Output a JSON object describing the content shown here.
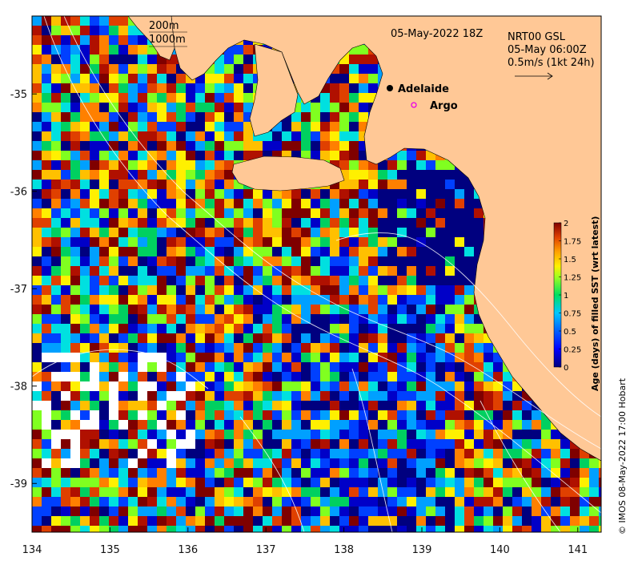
{
  "map": {
    "title": "05-May-2022 18Z",
    "contour_labels": [
      "200m",
      "1000m"
    ],
    "info_lines": [
      "NRT00 GSL",
      "05-May 06:00Z",
      "0.5m/s (1kt 24h)"
    ],
    "places": [
      {
        "name": "Adelaide",
        "lon": 138.6,
        "lat": -34.93,
        "marker": "filled-circle"
      },
      {
        "name": "Argo",
        "lon": 138.8,
        "lat": -35.12,
        "marker": "open-circle"
      }
    ],
    "lon_ticks": [
      "134",
      "135",
      "136",
      "137",
      "138",
      "139",
      "140",
      "141"
    ],
    "lat_ticks": [
      "-35",
      "-36",
      "-37",
      "-38",
      "-39"
    ],
    "lon_range": [
      134,
      141.3
    ],
    "lat_range": [
      -39.5,
      -34.2
    ],
    "land_color": "#FFC896",
    "colorbar": {
      "title": "Age (days) of filled SST (wrt latest)",
      "ticks": [
        "0",
        "0.25",
        "0.5",
        "0.75",
        "1",
        "1.25",
        "1.5",
        "1.75",
        "2"
      ],
      "range": [
        0,
        2
      ]
    },
    "credit": "© IMOS 08-May-2022 17:00 Hobart"
  }
}
